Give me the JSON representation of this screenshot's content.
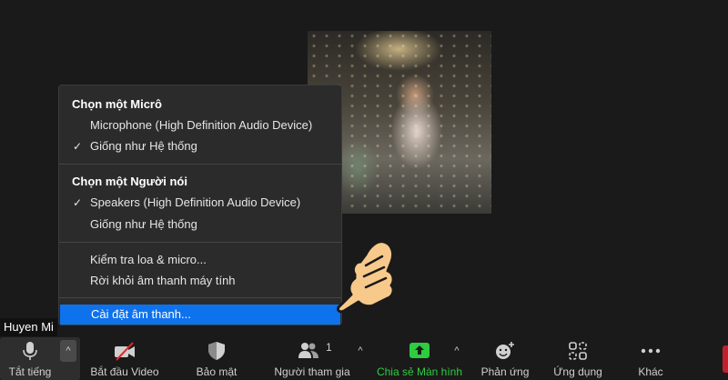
{
  "menu": {
    "mic_header": "Chọn một Micrô",
    "mic_items": [
      {
        "label": "Microphone (High Definition Audio Device)",
        "checked": false
      },
      {
        "label": "Giống như Hệ thống",
        "checked": true
      }
    ],
    "speaker_header": "Chọn một Người nói",
    "speaker_items": [
      {
        "label": "Speakers (High Definition Audio Device)",
        "checked": true
      },
      {
        "label": "Giống như Hệ thống",
        "checked": false
      }
    ],
    "test_label": "Kiểm tra loa & micro...",
    "leave_audio_label": "Rời khỏi âm thanh máy tính",
    "settings_label": "Cài đặt âm thanh...",
    "check_glyph": "✓"
  },
  "participant_name": "Huyen Mi",
  "toolbar": {
    "mute_label": "Tắt tiếng",
    "video_label": "Bắt đầu Video",
    "security_label": "Bảo mật",
    "participants_label": "Người tham gia",
    "participants_count": "1",
    "share_label": "Chia sẻ Màn hình",
    "reactions_label": "Phản ứng",
    "apps_label": "Ứng dụng",
    "more_label": "Khác",
    "caret": "^"
  },
  "colors": {
    "highlight": "#0e72ed",
    "share_green": "#2ecc40",
    "background": "#1a1a1a",
    "video_off_red": "#e02828"
  }
}
